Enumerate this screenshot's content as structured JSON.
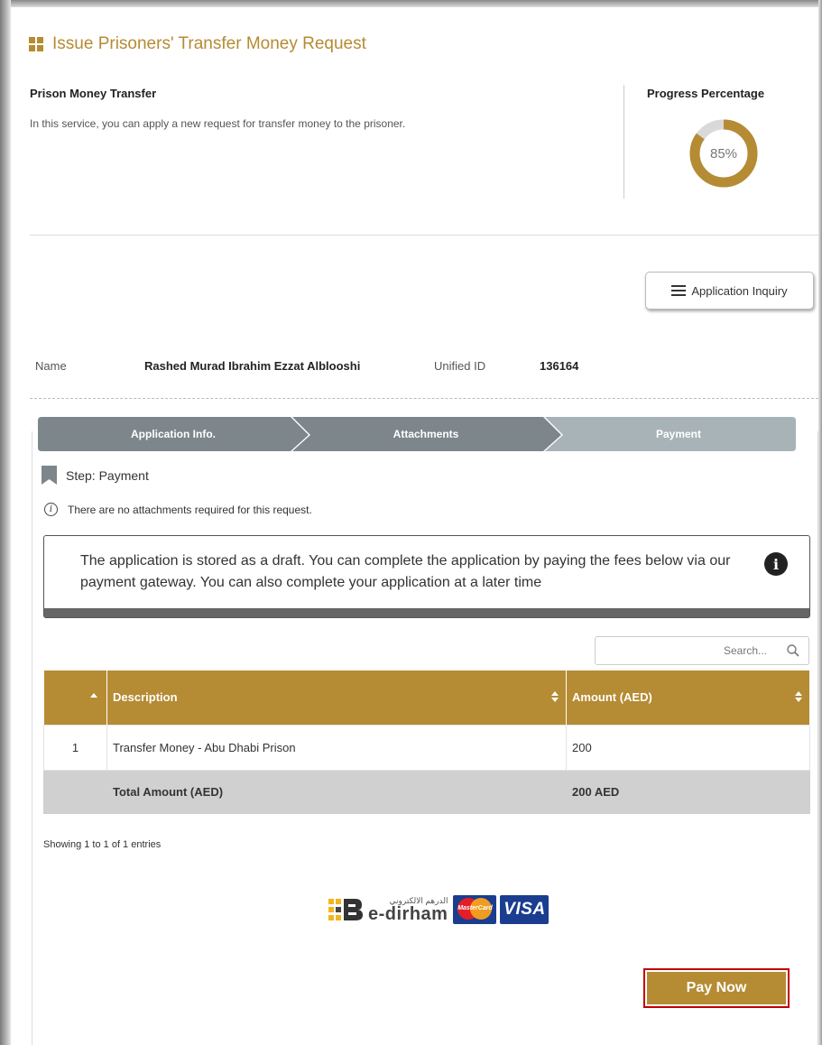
{
  "header": {
    "title": "Issue Prisoners' Transfer Money Request",
    "icon": "grid-icon"
  },
  "service": {
    "name": "Prison Money Transfer",
    "description": "In this service, you can apply a new request for transfer money to the prisoner."
  },
  "progress": {
    "label": "Progress Percentage",
    "value": 85,
    "text": "85%",
    "color": "#b58b34",
    "track_color": "#d9d9d9"
  },
  "inquiry_button": {
    "label": "Application Inquiry",
    "icon": "list-icon"
  },
  "applicant": {
    "name_label": "Name",
    "name_value": "Rashed Murad Ibrahim Ezzat Alblooshi",
    "id_label": "Unified ID",
    "id_value": "136164"
  },
  "steps": [
    {
      "label": "Application Info.",
      "state": "done"
    },
    {
      "label": "Attachments",
      "state": "done"
    },
    {
      "label": "Payment",
      "state": "current"
    }
  ],
  "step_info": {
    "title": "Step: Payment",
    "no_attachments": "There are no attachments required for this request."
  },
  "draft_notice": {
    "text": "The application is stored as a draft. You can complete the application by paying the fees below via our payment gateway. You can also complete your application at a later time"
  },
  "search": {
    "placeholder": "Search..."
  },
  "table": {
    "headers": {
      "index": "",
      "description": "Description",
      "amount": "Amount (AED)"
    },
    "rows": [
      {
        "index": "1",
        "description": "Transfer Money - Abu Dhabi Prison",
        "amount": "200"
      }
    ],
    "total": {
      "label": "Total Amount (AED)",
      "value": "200 AED"
    },
    "info": "Showing 1 to 1 of 1 entries"
  },
  "payment_methods": {
    "edirham_ar": "الدرهم الالكتروني",
    "edirham_en": "e-dirham",
    "mastercard": "MasterCard",
    "visa": "VISA"
  },
  "pay_button": {
    "label": "Pay Now"
  },
  "colors": {
    "accent": "#b58b34",
    "step_done": "#7d868b",
    "step_current": "#a8b3b8",
    "highlight": "#c00000"
  }
}
